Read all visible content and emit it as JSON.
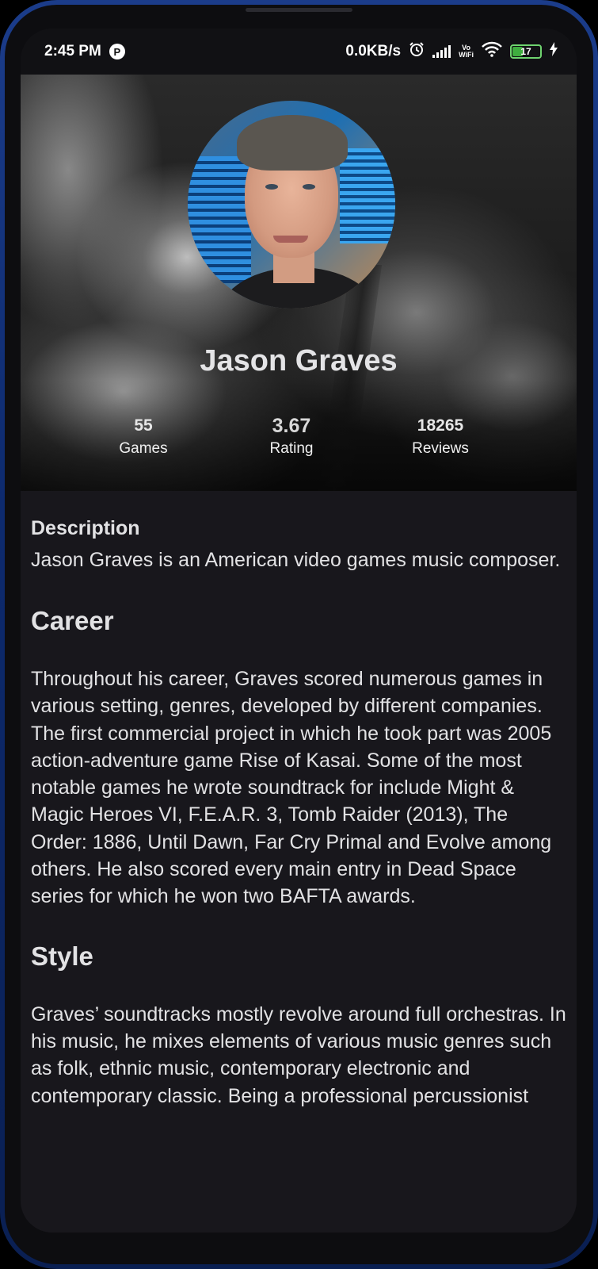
{
  "status_bar": {
    "time": "2:45 PM",
    "app_badge": "P",
    "network_speed": "0.0KB/s",
    "vowifi_top": "Vo",
    "vowifi_bottom": "WiFi",
    "battery_level": "17",
    "icons": [
      "alarm-icon",
      "signal-icon",
      "wifi-icon",
      "battery-icon",
      "charging-icon"
    ]
  },
  "profile": {
    "name": "Jason Graves",
    "stats": [
      {
        "value": "55",
        "label": "Games"
      },
      {
        "value": "3.67",
        "label": "Rating"
      },
      {
        "value": "18265",
        "label": "Reviews"
      }
    ]
  },
  "content": {
    "description_heading": "Description",
    "description_text": "Jason Graves is an American video games music composer.",
    "career_heading": "Career",
    "career_text": "Throughout his career, Graves scored numerous games in various setting, genres, developed by different companies. The first commercial project in which he took part was 2005 action-adventure game Rise of Kasai. Some of the most notable games he wrote soundtrack for include Might & Magic Heroes VI, F.E.A.R. 3, Tomb Raider (2013), The Order: 1886, Until Dawn, Far Cry Primal and Evolve among others. He also scored every main entry in Dead Space series for which he won two BAFTA awards.",
    "style_heading": "Style",
    "style_text": "Graves’ soundtracks mostly revolve around full orchestras. In his music, he mixes elements of various music genres such as folk, ethnic music, contemporary electronic and contemporary classic. Being a professional percussionist"
  },
  "colors": {
    "background": "#18171c",
    "text": "#e2e2e4",
    "frame_blue": "#1b3c8a",
    "battery_green": "#6fd36f"
  }
}
